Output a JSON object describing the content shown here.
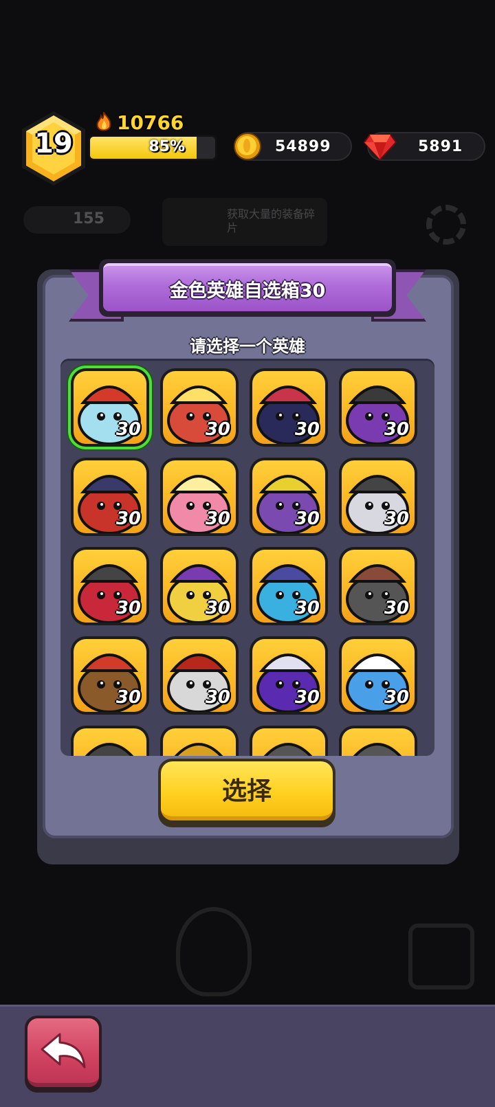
{
  "hud": {
    "level": "19",
    "power": "10766",
    "xp_percent_label": "85%",
    "xp_fraction": 0.85,
    "coins": "54899",
    "gems": "5891",
    "icons": [
      "hexagon-level-badge",
      "flame-icon",
      "coin-icon",
      "ruby-gem-icon"
    ]
  },
  "background": {
    "stamina": "155",
    "notice": "获取大量的装备碎片"
  },
  "dialog": {
    "title": "金色英雄自选箱30",
    "subtitle": "请选择一个英雄",
    "select_label": "选择",
    "heroes": [
      {
        "level": "30",
        "selected": true
      },
      {
        "level": "30",
        "selected": false
      },
      {
        "level": "30",
        "selected": false
      },
      {
        "level": "30",
        "selected": false
      },
      {
        "level": "30",
        "selected": false
      },
      {
        "level": "30",
        "selected": false
      },
      {
        "level": "30",
        "selected": false
      },
      {
        "level": "30",
        "selected": false
      },
      {
        "level": "30",
        "selected": false
      },
      {
        "level": "30",
        "selected": false
      },
      {
        "level": "30",
        "selected": false
      },
      {
        "level": "30",
        "selected": false
      },
      {
        "level": "30",
        "selected": false
      },
      {
        "level": "30",
        "selected": false
      },
      {
        "level": "30",
        "selected": false
      },
      {
        "level": "30",
        "selected": false
      },
      {
        "level": "",
        "selected": false
      },
      {
        "level": "",
        "selected": false
      },
      {
        "level": "",
        "selected": false
      },
      {
        "level": "",
        "selected": false
      }
    ]
  },
  "footer": {
    "back_icon": "back-arrow-icon"
  },
  "colors": {
    "selected_outline": "#4ede3a",
    "card_bg": "#fbb623",
    "banner": "#ae6bd8",
    "button": "#ffd01f",
    "back_button": "#d24563"
  }
}
